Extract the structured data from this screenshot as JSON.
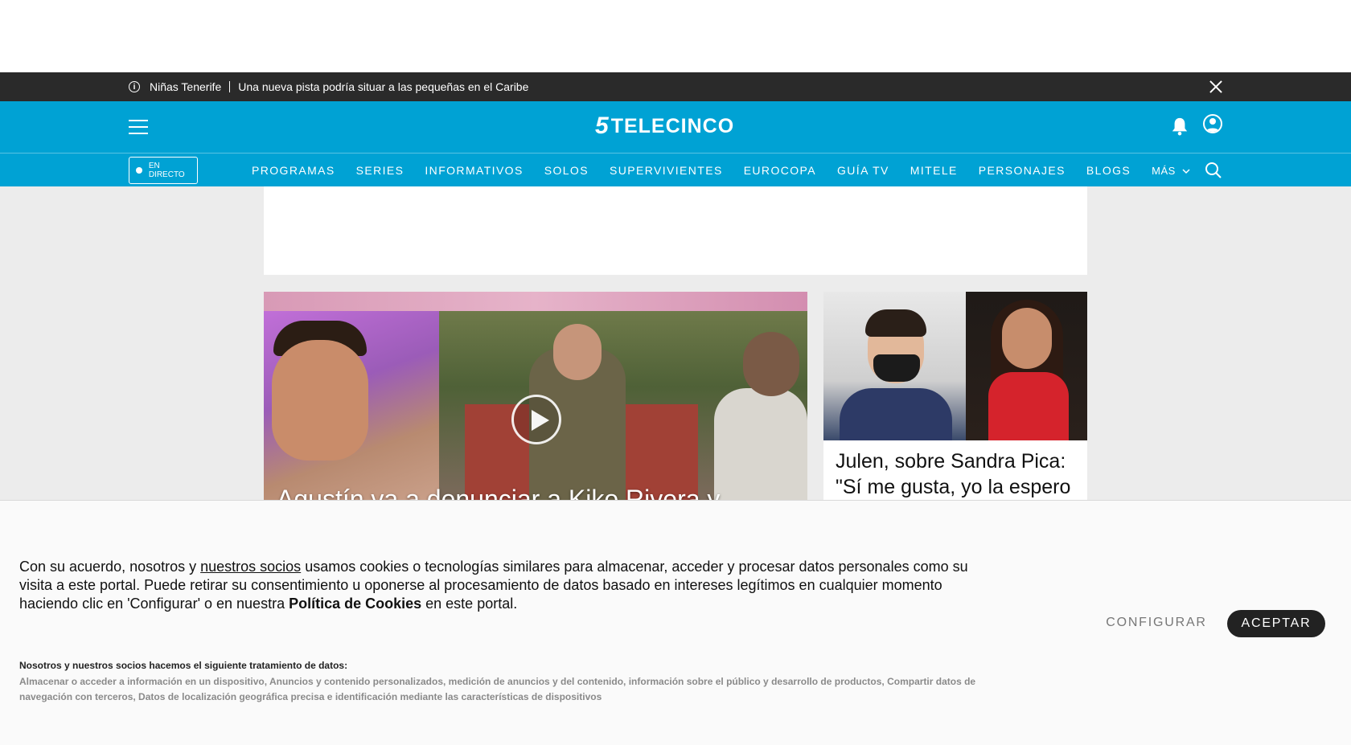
{
  "breaking": {
    "tag": "Niñas Tenerife",
    "headline": "Una nueva pista podría situar a las pequeñas en el Caribe"
  },
  "header": {
    "logo_mark": "5",
    "logo_text": "TELECINCO"
  },
  "nav": {
    "live_label": "EN DIRECTO",
    "items": [
      "PROGRAMAS",
      "SERIES",
      "INFORMATIVOS",
      "SOLOS",
      "SUPERVIVIENTES",
      "EUROCOPA",
      "GUÍA TV",
      "MITELE",
      "PERSONAJES",
      "BLOGS"
    ],
    "more_label": "MÁS"
  },
  "hero": {
    "title": "Agustín va a denunciar a Kiko Rivera y"
  },
  "card": {
    "headline": "Julen, sobre Sandra Pica: \"Sí me gusta, yo la espero"
  },
  "consent": {
    "text_before_link": "Con su acuerdo, nosotros y ",
    "partners_link": "nuestros socios",
    "text_after_link": " usamos cookies o tecnologías similares para almacenar, acceder y procesar datos personales como su visita a este portal. Puede retirar su consentimiento u oponerse al procesamiento de datos basado en intereses legítimos en cualquier momento haciendo clic en 'Configurar' o en nuestra ",
    "policy_link": "Política de Cookies",
    "text_end": " en este portal.",
    "configure_label": "CONFIGURAR",
    "accept_label": "ACEPTAR",
    "partners_title": "Nosotros y nuestros socios hacemos el siguiente tratamiento de datos:",
    "purposes": "Almacenar o acceder a información en un dispositivo, Anuncios y contenido personalizados, medición de anuncios y del contenido, información sobre el público y desarrollo de productos, Compartir datos de navegación con terceros, Datos de localización geográfica precisa e identificación mediante las características de dispositivos"
  },
  "colors": {
    "brand": "#00a2d4",
    "breaking_bg": "#2a2a2a",
    "accept_bg": "#222222"
  }
}
